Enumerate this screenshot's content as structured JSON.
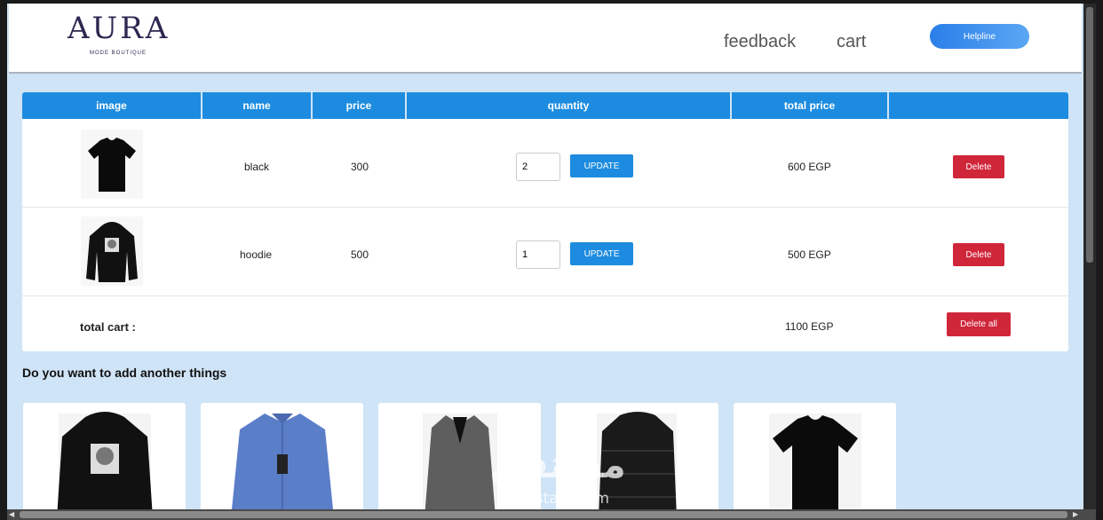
{
  "header": {
    "logo_text": "AURA",
    "logo_sub": "MODE BOUTIQUE",
    "nav": [
      "feedback",
      "cart"
    ],
    "helpline_label": "Helpline"
  },
  "cart": {
    "columns": [
      "image",
      "name",
      "price",
      "quantity",
      "total price",
      ""
    ],
    "items": [
      {
        "image": "black-tshirt",
        "name": "black",
        "price": "300",
        "quantity": "2",
        "update_label": "UPDATE",
        "total": "600 EGP",
        "delete_label": "Delete"
      },
      {
        "image": "black-hoodie",
        "name": "hoodie",
        "price": "500",
        "quantity": "1",
        "update_label": "UPDATE",
        "total": "500 EGP",
        "delete_label": "Delete"
      }
    ],
    "total_label": "total cart :",
    "total_value": "1100 EGP",
    "delete_all_label": "Delete all"
  },
  "suggestions": {
    "title": "Do you want to add another things",
    "products": [
      "black-hoodie",
      "blue-shirt",
      "grey-coat",
      "black-puffer-jacket",
      "black-tshirt"
    ]
  },
  "watermark": {
    "text": "مستقل",
    "sub": "mostaql.com"
  },
  "colors": {
    "primary": "#1d8ce0",
    "danger": "#d0263a",
    "page_bg": "#cfe4f6"
  }
}
